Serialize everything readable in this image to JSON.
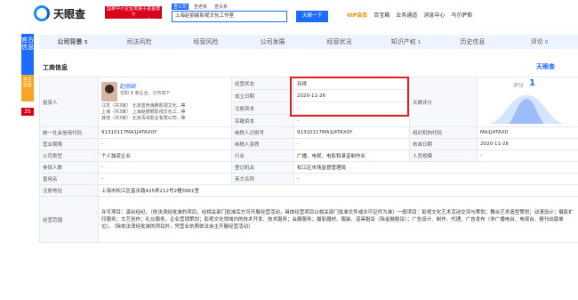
{
  "header": {
    "logo_text": "天眼查",
    "logo_url": "TianYancha.com",
    "red_badge_line1": "国家中小企业发展子基金旗下",
    "red_badge_line2": "官方备案企业征信机构",
    "search_tabs": [
      "查公司",
      "查老板",
      "查关系"
    ],
    "search_value": "上海赵丽颖影视文化工作室",
    "search_button": "天眼一下",
    "nav": [
      "VIP会员",
      "百宝箱",
      "业务通道",
      "消息中心",
      "马尔萨斯"
    ]
  },
  "left_tabs": {
    "official": "官方信息",
    "self": "自主信息",
    "count": "35"
  },
  "tabs": [
    "公司背景",
    "司法风险",
    "经营风险",
    "公司发展",
    "经营状况",
    "知识产权",
    "历史信息",
    "评论"
  ],
  "tab_counts": {
    "公司背景": "5",
    "知识产权": "1",
    "评论": "0"
  },
  "section_title": "工商信息",
  "section_logo": "天眼查",
  "info": {
    "investor_label": "投资人",
    "person_name": "赵丽颖",
    "person_sub": "任职 9 家企业，分布如下",
    "person_list": [
      "江苏（共3家）  北京蓝色海豚影视文化...等",
      "上海（共3家）  上海赵丽颖影视文化工...等",
      "其他（共3家）  北京青哥影业有限公司...等"
    ],
    "status_label": "经营状态",
    "status_value": "存续",
    "established_label": "成立日期",
    "established_value": "2020-11-26",
    "capital_label": "注册资本",
    "capital_value": "-",
    "paid_capital_label": "实缴资本",
    "paid_capital_value": "-",
    "score_label": "天眼评分",
    "score_title": "评分",
    "score_value": "1",
    "reg_no_label": "工商注册号",
    "reg_no_value": "-",
    "credit_code_label": "统一社会信用代码",
    "credit_code_value": "91310117MA1J4TAX0Y",
    "tax_id_label": "纳税人识别号",
    "tax_id_value": "91310117MA1J4TAX0Y",
    "org_code_label": "组织机构代码",
    "org_code_value": "MA1J4TAX0",
    "term_label": "营业期限",
    "term_value": "-",
    "tax_qual_label": "纳税人资质",
    "tax_qual_value": "-",
    "approval_label": "核准日期",
    "approval_value": "2020-11-26",
    "type_label": "公司类型",
    "type_value": "个人独资企业",
    "industry_label": "行业",
    "industry_value": "广播、电视、电影和录音制作业",
    "staff_label": "人员规模",
    "staff_value": "-",
    "insured_label": "参保人数",
    "insured_value": "-",
    "authority_label": "登记机关",
    "authority_value": "松江区市场监督管理局",
    "former_label": "曾用名",
    "former_value": "-",
    "english_label": "英文名称",
    "english_value": "-",
    "address_label": "注册地址",
    "address_value": "上海市松江区富永路425弄212号2幢3961室",
    "scope_label": "经营范围",
    "scope_value": "许可项目：演出经纪。（依法须经批准的项目，经相关部门批准后方可开展经营活动，具体经营项目以相关部门批准文件或许可证件为准）一般项目：影视文化艺术活动交流与策划；舞台艺术造型策划；动漫设计；摄影扩印服务；文艺创作；礼仪服务，企业营销策划；影视文化领域内的技术开发、技术服务；会展服务；摄影器材、服装、道具租赁（除金融租赁）；广告设计、制作、代理，广告发布（非广播电台、电视台、报刊出版单位）。（除依法须经批准的项目外，凭营业执照依法自主开展经营活动）"
  }
}
